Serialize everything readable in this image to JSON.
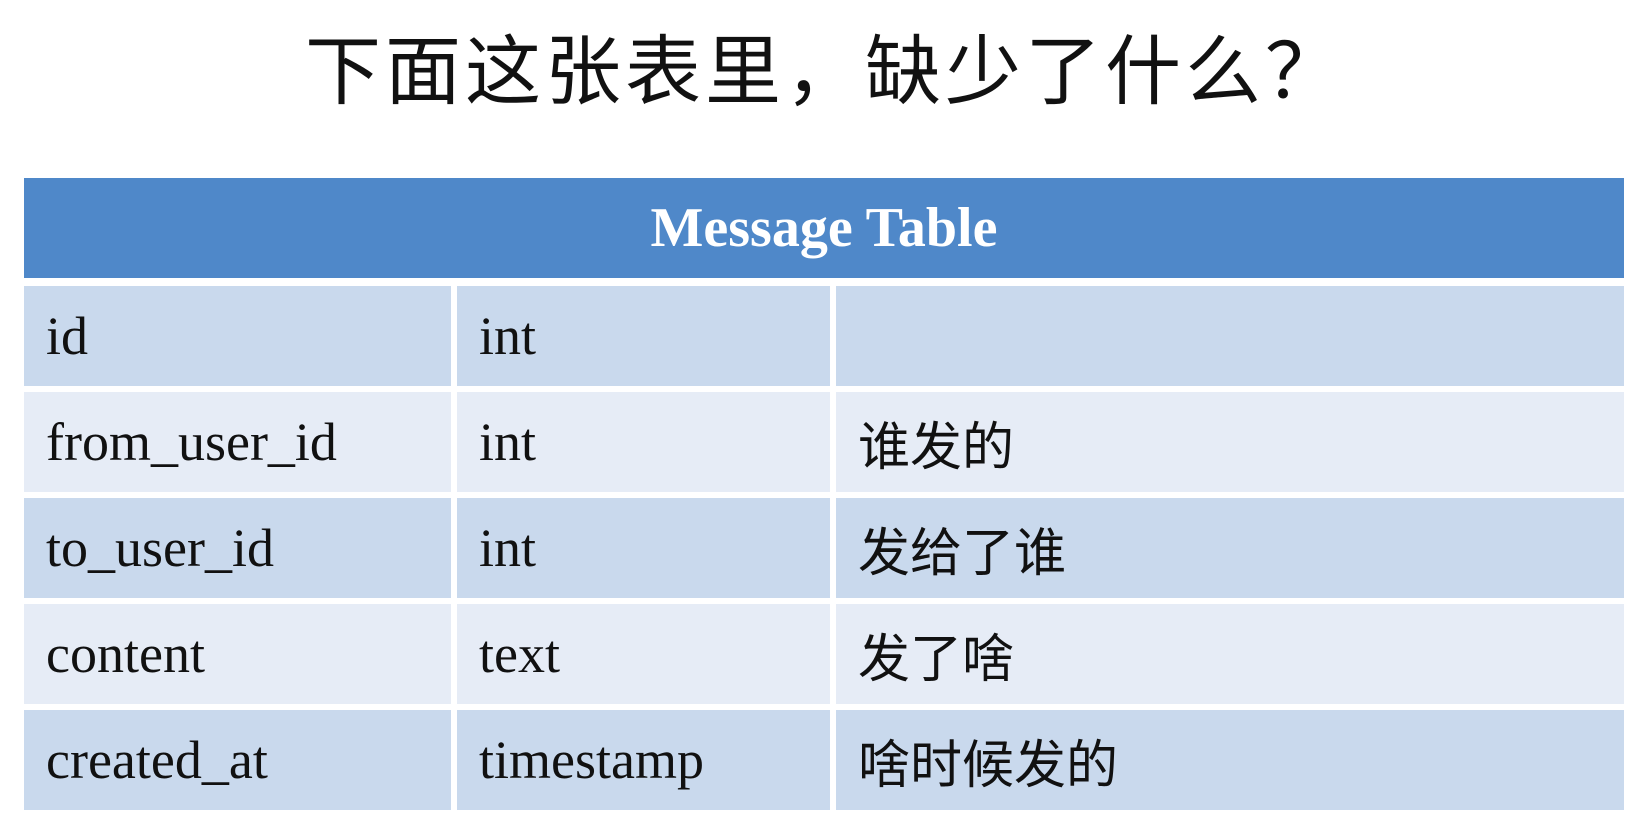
{
  "slide": {
    "title": "下面这张表里，缺少了什么？"
  },
  "table": {
    "title": "Message Table",
    "rows": [
      {
        "name": "id",
        "type": "int",
        "note": ""
      },
      {
        "name": "from_user_id",
        "type": "int",
        "note": "谁发的"
      },
      {
        "name": "to_user_id",
        "type": "int",
        "note": "发给了谁"
      },
      {
        "name": "content",
        "type": "text",
        "note": "发了啥"
      },
      {
        "name": "created_at",
        "type": "timestamp",
        "note": "啥时候发的"
      }
    ]
  },
  "colors": {
    "header_bg": "#4f88c9",
    "row_dark": "#c9d9ed",
    "row_light": "#e6ecf6"
  }
}
